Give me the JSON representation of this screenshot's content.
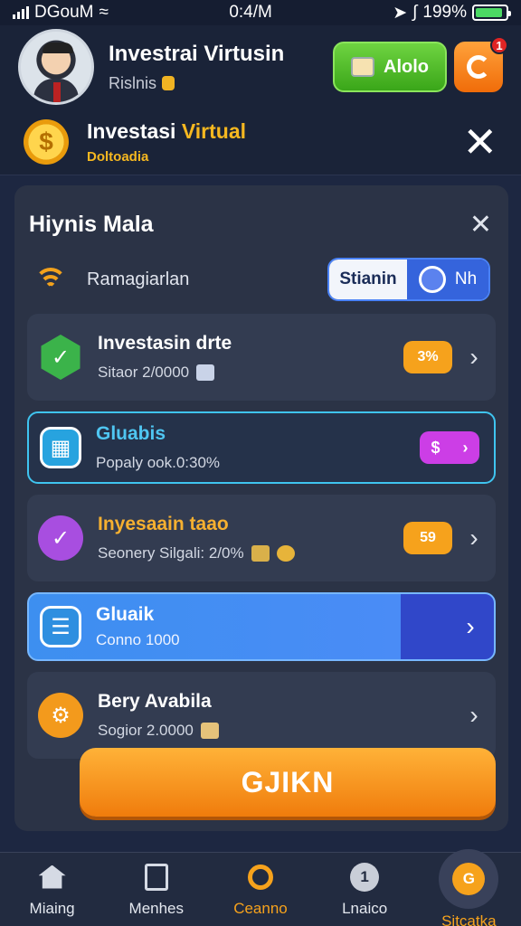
{
  "status": {
    "carrier": "DGouM",
    "time": "0:4/M",
    "battery": "199%"
  },
  "header": {
    "title": "Investrai Virtusin",
    "subtitle": "Rislnis",
    "green_button_label": "Alolo",
    "notification_count": "1"
  },
  "subheader": {
    "title_white": "Investasi ",
    "title_accent": "Virtual",
    "subtitle": "Doltoadia"
  },
  "panel": {
    "title": "Hiynis Mala",
    "toggle_label": "Ramagiarlan",
    "segment_a": "Stianin",
    "segment_b": "Nh",
    "items": [
      {
        "title": "Investasin drte",
        "subtitle": "Sitaor 2/0000",
        "pill": "3%",
        "icon": "check-badge-icon"
      },
      {
        "title": "Gluabis",
        "subtitle": "Popaly ook.0:30%",
        "pill": "$",
        "icon": "chart-icon"
      },
      {
        "title": "Inyesaain taao",
        "subtitle": "Seonery Silgali: 2/0%",
        "pill": "59",
        "icon": "heart-check-icon"
      },
      {
        "title": "Gluaik",
        "subtitle": "Conno 1000",
        "icon": "note-icon"
      },
      {
        "title": "Bery Avabila",
        "subtitle": "Sogior 2.0000",
        "icon": "gear-icon"
      }
    ],
    "cta_label": "GJIKN"
  },
  "tabs": [
    {
      "label": "Miaing",
      "icon": "home-icon"
    },
    {
      "label": "Menhes",
      "icon": "document-icon"
    },
    {
      "label": "Ceanno",
      "icon": "search-icon"
    },
    {
      "label": "Lnaico",
      "icon": "info-icon"
    },
    {
      "label": "Sitcatka",
      "icon": "star-icon"
    }
  ],
  "colors": {
    "background": "#1d2741",
    "accent_orange": "#f6a21c",
    "accent_cyan": "#3fc4ef",
    "accent_blue": "#3564dc",
    "accent_green": "#3aa619"
  }
}
